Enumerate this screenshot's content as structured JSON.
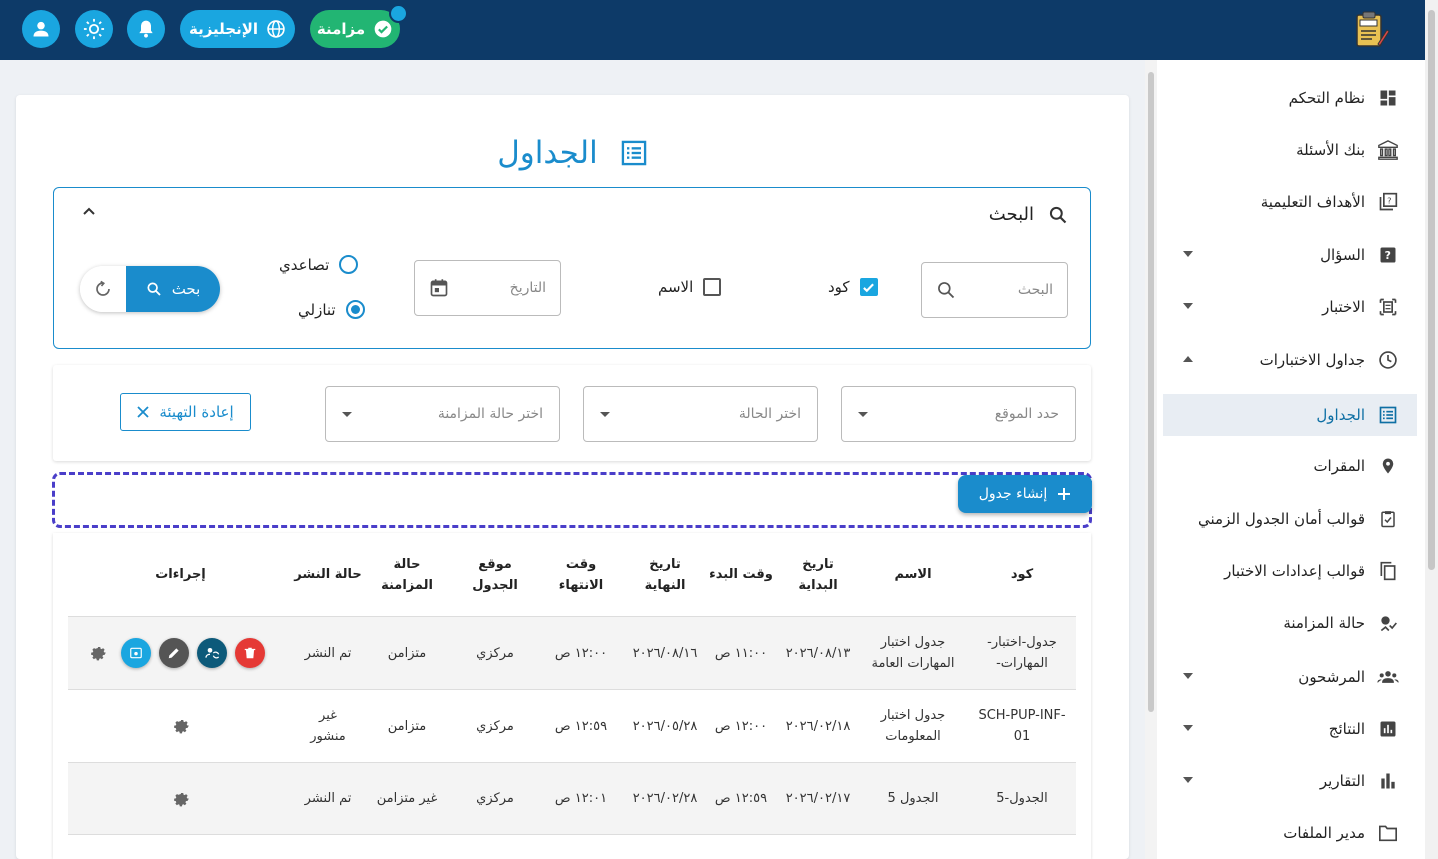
{
  "topbar": {
    "sync_label": "مزامنة",
    "language_label": "الإنجليزية",
    "colors": {
      "bg": "#0d3a68",
      "accent": "#1aa6e0",
      "sync": "#22b573"
    }
  },
  "sidebar": {
    "items": [
      {
        "label": "نظام التحكم",
        "icon": "dashboard-icon"
      },
      {
        "label": "بنك الأسئلة",
        "icon": "bank-icon"
      },
      {
        "label": "الأهداف التعليمية",
        "icon": "quiz-icon"
      },
      {
        "label": "السؤال",
        "icon": "help-icon"
      },
      {
        "label": "الاختبار",
        "icon": "exam-icon"
      },
      {
        "label": "جداول الاختبارات",
        "icon": "clock-icon"
      },
      {
        "label": "الجداول",
        "icon": "list-icon"
      },
      {
        "label": "المقرات",
        "icon": "location-icon"
      },
      {
        "label": "قوالب أمان الجدول الزمني",
        "icon": "calendar-check-icon"
      },
      {
        "label": "قوالب إعدادات الاختبار",
        "icon": "copy-icon"
      },
      {
        "label": "حالة المزامنة",
        "icon": "sync-status-icon"
      },
      {
        "label": "المرشحون",
        "icon": "group-icon"
      },
      {
        "label": "النتائج",
        "icon": "chart-box-icon"
      },
      {
        "label": "التقارير",
        "icon": "bar-chart-icon"
      },
      {
        "label": "مدير الملفات",
        "icon": "folder-icon"
      }
    ]
  },
  "page": {
    "title": "الجداول"
  },
  "search": {
    "heading": "البحث",
    "input_placeholder": "البحث",
    "code_label": "كود",
    "name_label": "الاسم",
    "date_placeholder": "التاريخ",
    "asc_label": "تصاعدي",
    "desc_label": "تنازلي",
    "search_button": "بحث"
  },
  "filters": {
    "location_placeholder": "حدد الموقع",
    "status_placeholder": "اختر الحالة",
    "sync_placeholder": "اختر حالة المزامنة",
    "reset_label": "إعادة التهيئة"
  },
  "create_button": "إنشاء جدول",
  "table": {
    "headers": {
      "code": "كود",
      "name": "الاسم",
      "start_date": "تاريخ البداية",
      "start_time": "وقت البدء",
      "end_date": "تاريخ النهاية",
      "end_time": "وقت الانتهاء",
      "location": "موقع الجدول",
      "sync_status": "حالة المزامنة",
      "publish_status": "حالة النشر",
      "actions": "إجراءات"
    },
    "rows": [
      {
        "code": "جدول-اختبار-المهارات-",
        "name": "جدول اختبار المهارات العامة",
        "start_date": "٢٠٢٦/٠٨/١٣",
        "start_time": "١١:٠٠ ص",
        "end_date": "٢٠٢٦/٠٨/١٦",
        "end_time": "١٢:٠٠ ص",
        "location": "مركزي",
        "sync": "متزامن",
        "publish": "تم النشر"
      },
      {
        "code": "SCH-PUP-INF-01",
        "name": "جدول اختبار المعلومات",
        "start_date": "٢٠٢٦/٠٢/١٨",
        "start_time": "١٢:٠٠ ص",
        "end_date": "٢٠٢٦/٠٥/٢٨",
        "end_time": "١٢:٥٩ ص",
        "location": "مركزي",
        "sync": "متزامن",
        "publish": "غير منشور"
      },
      {
        "code": "الجدول-5",
        "name": "الجدول 5",
        "start_date": "٢٠٢٦/٠٢/١٧",
        "start_time": "١٢:٥٩ ص",
        "end_date": "٢٠٢٦/٠٢/٢٨",
        "end_time": "١٢:٠١ ص",
        "location": "مركزي",
        "sync": "غير متزامن",
        "publish": "تم النشر"
      }
    ]
  }
}
